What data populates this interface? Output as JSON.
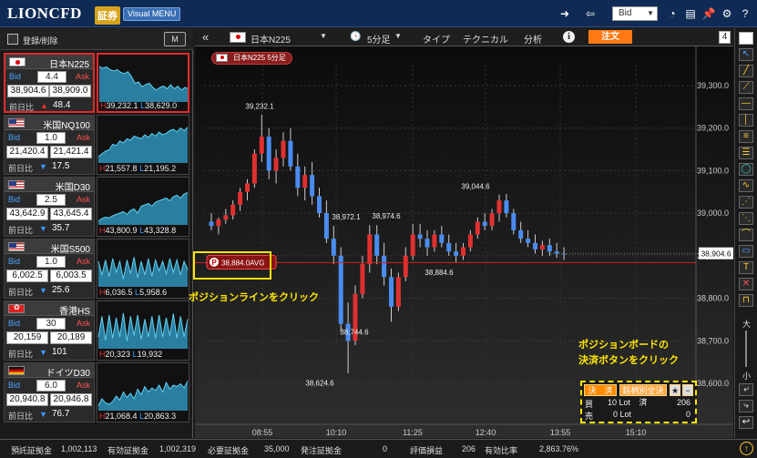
{
  "header": {
    "logo": "LIONCFD",
    "logo_badge": "証券",
    "menu_button": "Visual MENU",
    "price_type": "Bid"
  },
  "left_panel": {
    "register_label": "登録/削除",
    "mode_button": "M",
    "instruments": [
      {
        "name": "日本N225",
        "flag": "jp",
        "spread": "4.4",
        "bid": "38,904.6",
        "ask": "38,909.0",
        "change_label": "前日比",
        "direction": "up",
        "change": "48.4",
        "high": "39,232.1",
        "low": "38,629.0",
        "high_marker": "H",
        "low_marker": "L"
      },
      {
        "name": "米国NQ100",
        "flag": "us",
        "spread": "1.0",
        "bid": "21,420.4",
        "ask": "21,421.4",
        "change_label": "前日比",
        "direction": "down",
        "change": "17.5",
        "high": "21,557.8",
        "low": "21,195.2",
        "high_marker": "H",
        "low_marker": "L"
      },
      {
        "name": "米国D30",
        "flag": "us",
        "spread": "2.5",
        "bid": "43,642.9",
        "ask": "43,645.4",
        "change_label": "前日比",
        "direction": "down",
        "change": "35.7",
        "high": "43,800.9",
        "low": "43,328.8",
        "high_marker": "H",
        "low_marker": "L"
      },
      {
        "name": "米国S500",
        "flag": "us",
        "spread": "1.0",
        "bid": "6,002.5",
        "ask": "6,003.5",
        "change_label": "前日比",
        "direction": "down",
        "change": "25.6",
        "high": "6,036.5",
        "low": "5,958.6",
        "high_marker": "H",
        "low_marker": "L"
      },
      {
        "name": "香港HS",
        "flag": "hk",
        "spread": "30",
        "bid": "20,159",
        "ask": "20,189",
        "change_label": "前日比",
        "direction": "down",
        "change": "101",
        "high": "20,323",
        "low": "19,932",
        "high_marker": "H",
        "low_marker": "L"
      },
      {
        "name": "ドイツD30",
        "flag": "de",
        "spread": "6.0",
        "bid": "20,940.8",
        "ask": "20,946.8",
        "change_label": "前日比",
        "direction": "down",
        "change": "76.7",
        "high": "21,068.4",
        "low": "20,863.3",
        "high_marker": "H",
        "low_marker": "L"
      }
    ],
    "bid_label": "Bid",
    "ask_label": "Ask"
  },
  "chart_toolbar": {
    "symbol": "日本N225",
    "timeframe": "5分足",
    "type": "タイプ",
    "technical": "テクニカル",
    "analysis": "分析",
    "order": "注文",
    "panel_count": "4"
  },
  "chart_chip": "日本N225 5分足",
  "chart_data": {
    "type": "candlestick",
    "price_axis": [
      "39,300.0",
      "39,200.0",
      "39,100.0",
      "39,000.0",
      "38,900.0",
      "38,800.0",
      "38,700.0",
      "38,600.0"
    ],
    "time_axis": [
      "08:55",
      "10:10",
      "11:25",
      "12:40",
      "13:55",
      "15:10"
    ],
    "current_price": "38,904.6",
    "position_line_label": "38,884.0AVG",
    "position_line_marker": "P",
    "annotations": [
      "39,232.1",
      "38,972.1",
      "38,974.6",
      "39,044.6",
      "38,884.6",
      "38,744.6",
      "38,624.6"
    ]
  },
  "annotations": {
    "position_line": "ポジションラインをクリック",
    "board_line1": "ポジションボードの",
    "board_line2": "決済ボタンをクリック"
  },
  "position_board": {
    "settle": "決　済",
    "by_brand": "銘柄別全決済",
    "buy_label": "買",
    "buy_lots": "10 Lot",
    "buy_pl": "206",
    "sell_label": "売",
    "sell_lots": "0 Lot",
    "sell_pl": "0"
  },
  "zoom": {
    "large": "大",
    "small": "小"
  },
  "status_bar": [
    {
      "label": "預託証拠金",
      "value": "1,002,113"
    },
    {
      "label": "有効証拠金",
      "value": "1,002,319"
    },
    {
      "label": "必要証拠金",
      "value": "35,000"
    },
    {
      "label": "発注証拠金",
      "value": "0"
    },
    {
      "label": "評価損益",
      "value": "206"
    },
    {
      "label": "有効比率",
      "value": "2,863.76%"
    }
  ]
}
